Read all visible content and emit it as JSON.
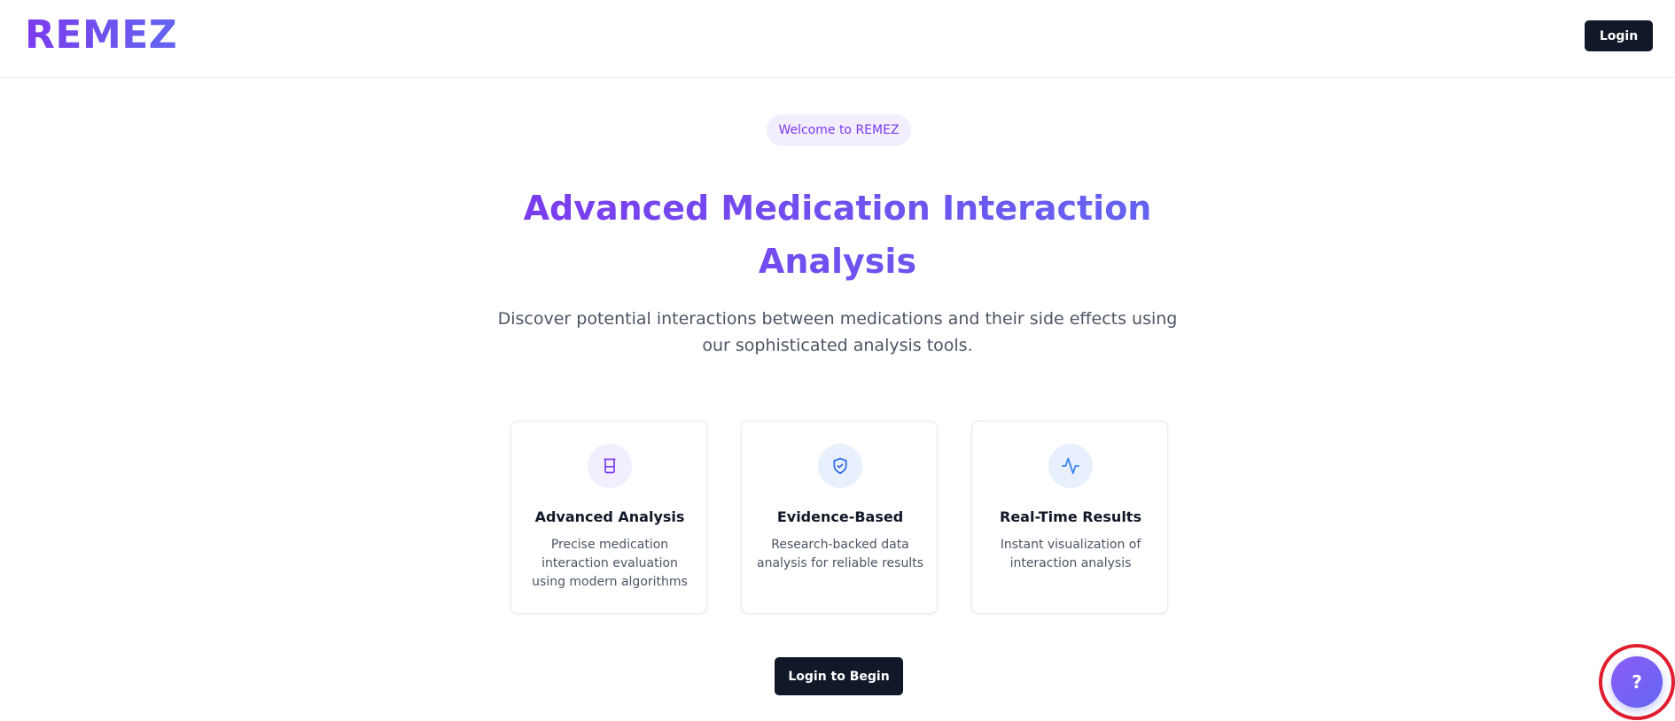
{
  "header": {
    "logo_text": "REMEZ",
    "login_label": "Login"
  },
  "hero": {
    "badge": "Welcome to REMEZ",
    "title": "Advanced Medication Interaction Analysis",
    "subtitle": "Discover potential interactions between medications and their side effects using our sophisticated analysis tools."
  },
  "features": [
    {
      "icon": "beaker-icon",
      "title": "Advanced Analysis",
      "description": "Precise medication interaction evaluation using modern algorithms"
    },
    {
      "icon": "shield-check-icon",
      "title": "Evidence-Based",
      "description": "Research-backed data analysis for reliable results"
    },
    {
      "icon": "activity-icon",
      "title": "Real-Time Results",
      "description": "Instant visualization of interaction analysis"
    }
  ],
  "cta": {
    "begin_label": "Login to Begin"
  },
  "help": {
    "label": "?"
  },
  "colors": {
    "brand_purple": "#7c3aed",
    "brand_indigo": "#6366f1",
    "dark_button": "#111827",
    "highlight_ring": "#e11d2e"
  }
}
